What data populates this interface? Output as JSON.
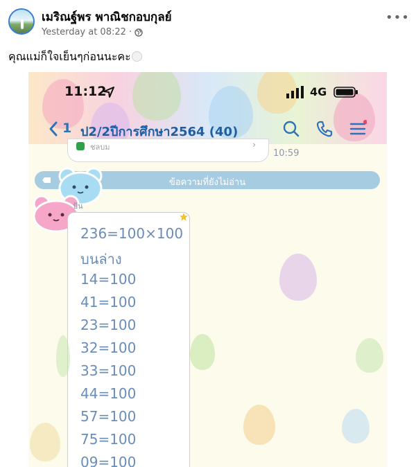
{
  "post": {
    "author": "เมริณฐ์พร พาณิชกอบกุลย์",
    "timestamp": "Yesterday at 08:22",
    "privacy_icon": "globe-icon",
    "more_icon": "more-options-icon",
    "more_label": "•••",
    "caption": "คุณแม่ก็ใจเย็นๆก่อนนะคะ",
    "caption_emoji": "neutral-face-emoji"
  },
  "phone": {
    "status_bar": {
      "time": "11:12",
      "network": "4G"
    },
    "nav": {
      "unread_count": "1",
      "chat_title": "ป2/2ปีการศึกษา2564 (40)"
    },
    "previous_message": {
      "preview": "ชลบม",
      "time": "10:59"
    },
    "unread_divider": "ข้อความที่ยังไม่อ่าน",
    "sender_name": "ปัน",
    "message_lines": [
      "236=100×100",
      "บนล่าง",
      "14=100",
      "41=100",
      "23=100",
      "32=100",
      "33=100",
      "44=100",
      "57=100",
      "75=100",
      "09=100"
    ]
  },
  "colors": {
    "chat_title": "#1e5fa3",
    "unread_bar": "#a6cce2",
    "message_text": "#6a8db8",
    "chat_background": "#fdfbec"
  }
}
